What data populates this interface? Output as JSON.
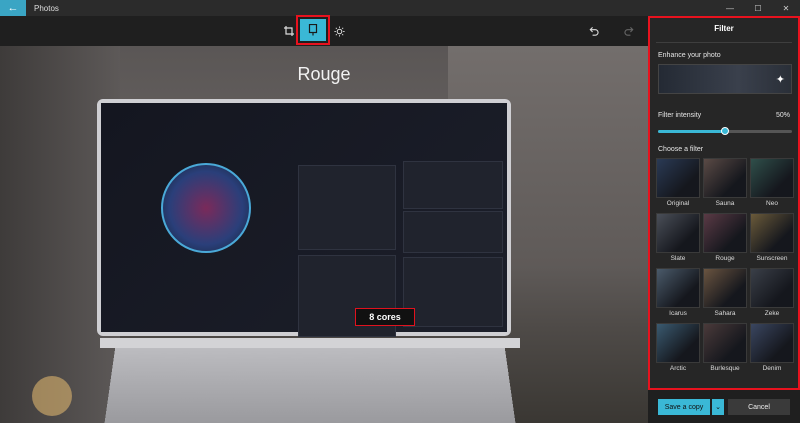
{
  "app": {
    "title": "Photos"
  },
  "window_controls": {
    "minimize": "—",
    "maximize": "☐",
    "close": "✕"
  },
  "toolbar": {
    "active_tool": "filter"
  },
  "photo": {
    "filter_name": "Rouge",
    "badge_text": "8 cores"
  },
  "filter_panel": {
    "title": "Filter",
    "enhance_label": "Enhance your photo",
    "intensity_label": "Filter intensity",
    "intensity_value": "50%",
    "intensity_fraction": 0.5,
    "choose_label": "Choose a filter",
    "filters": [
      {
        "name": "Original",
        "tint": "#2a3a55"
      },
      {
        "name": "Sauna",
        "tint": "#5a4a45"
      },
      {
        "name": "Neo",
        "tint": "#2f4f4a"
      },
      {
        "name": "Slate",
        "tint": "#4a4f58"
      },
      {
        "name": "Rouge",
        "tint": "#5a3a45"
      },
      {
        "name": "Sunscreen",
        "tint": "#6a5a3a"
      },
      {
        "name": "Icarus",
        "tint": "#4a5a6a"
      },
      {
        "name": "Sahara",
        "tint": "#6a5440"
      },
      {
        "name": "Zeke",
        "tint": "#3a3f48"
      },
      {
        "name": "Arctic",
        "tint": "#3a5a70"
      },
      {
        "name": "Burlesque",
        "tint": "#4a3a3a"
      },
      {
        "name": "Denim",
        "tint": "#3a4660"
      }
    ]
  },
  "footer": {
    "save_label": "Save a copy",
    "cancel_label": "Cancel"
  },
  "colors": {
    "accent": "#3ab8d6",
    "highlight": "#e8121e"
  }
}
